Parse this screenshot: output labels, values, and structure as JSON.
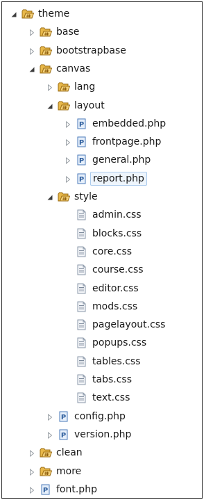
{
  "tree": {
    "rows": [
      {
        "label": "theme",
        "type": "folder",
        "expanded": true,
        "depth": 0
      },
      {
        "label": "base",
        "type": "folder",
        "expanded": false,
        "depth": 1
      },
      {
        "label": "bootstrapbase",
        "type": "folder",
        "expanded": false,
        "depth": 1
      },
      {
        "label": "canvas",
        "type": "folder",
        "expanded": true,
        "depth": 1
      },
      {
        "label": "lang",
        "type": "folder",
        "expanded": false,
        "depth": 2
      },
      {
        "label": "layout",
        "type": "folder",
        "expanded": true,
        "depth": 2
      },
      {
        "label": "embedded.php",
        "type": "php",
        "expanded": false,
        "depth": 3
      },
      {
        "label": "frontpage.php",
        "type": "php",
        "expanded": false,
        "depth": 3
      },
      {
        "label": "general.php",
        "type": "php",
        "expanded": false,
        "depth": 3
      },
      {
        "label": "report.php",
        "type": "php",
        "expanded": false,
        "depth": 3,
        "selected": true
      },
      {
        "label": "style",
        "type": "folder",
        "expanded": true,
        "depth": 2
      },
      {
        "label": "admin.css",
        "type": "css",
        "depth": 3
      },
      {
        "label": "blocks.css",
        "type": "css",
        "depth": 3
      },
      {
        "label": "core.css",
        "type": "css",
        "depth": 3
      },
      {
        "label": "course.css",
        "type": "css",
        "depth": 3
      },
      {
        "label": "editor.css",
        "type": "css",
        "depth": 3
      },
      {
        "label": "mods.css",
        "type": "css",
        "depth": 3
      },
      {
        "label": "pagelayout.css",
        "type": "css",
        "depth": 3
      },
      {
        "label": "popups.css",
        "type": "css",
        "depth": 3
      },
      {
        "label": "tables.css",
        "type": "css",
        "depth": 3
      },
      {
        "label": "tabs.css",
        "type": "css",
        "depth": 3
      },
      {
        "label": "text.css",
        "type": "css",
        "depth": 3
      },
      {
        "label": "config.php",
        "type": "php",
        "expanded": false,
        "depth": 2
      },
      {
        "label": "version.php",
        "type": "php",
        "expanded": false,
        "depth": 2
      },
      {
        "label": "clean",
        "type": "folder",
        "expanded": false,
        "depth": 1
      },
      {
        "label": "more",
        "type": "folder",
        "expanded": false,
        "depth": 1
      },
      {
        "label": "font.php",
        "type": "php",
        "expanded": false,
        "depth": 1
      }
    ]
  },
  "colors": {
    "folder_fill": "#e8b84a",
    "folder_stroke": "#9a6b12",
    "php_fill": "#e7f0fb",
    "php_stroke": "#4a79b8",
    "css_fill": "#f4f6f9",
    "css_stroke": "#8a97a8",
    "selection_bg": "#eef5fc",
    "selection_border": "#a9c9ec"
  }
}
